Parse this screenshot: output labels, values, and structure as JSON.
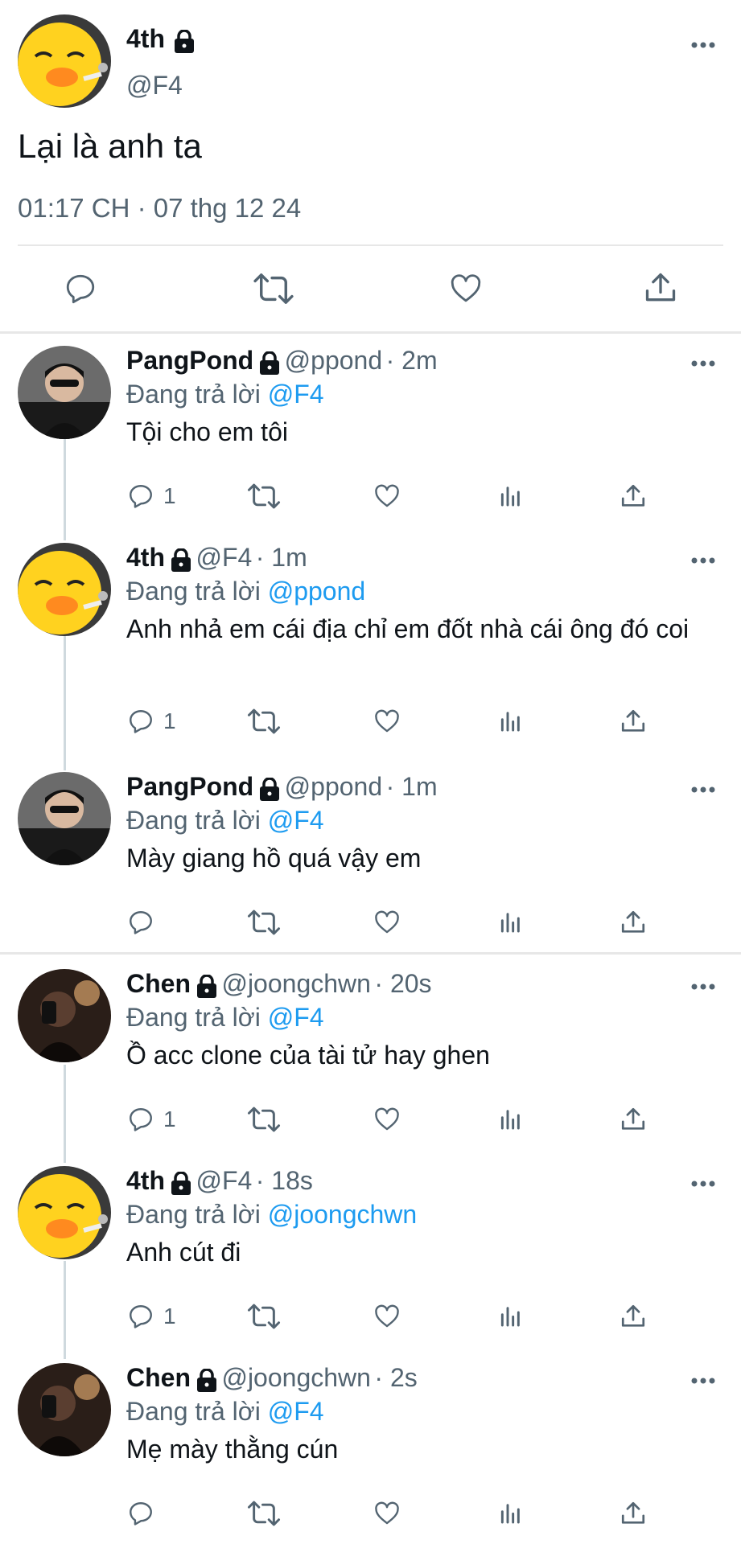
{
  "main_tweet": {
    "name": "4th",
    "handle": "@F4",
    "text": "Lại là anh ta",
    "timestamp": "01:17 CH · 07 thg 12 24"
  },
  "replies": [
    {
      "name": "PangPond",
      "handle": "@ppond",
      "time": "· 2m",
      "reply_prefix": "Đang trả lời",
      "reply_to": "@F4",
      "text": "Tội cho em tôi",
      "reply_count": "1",
      "avatar": "pangpond"
    },
    {
      "name": "4th",
      "handle": "@F4",
      "time": "· 1m",
      "reply_prefix": "Đang trả lời",
      "reply_to": "@ppond",
      "text": "Anh nhả em cái địa chỉ em đốt nhà cái ông đó coi",
      "reply_count": "1",
      "avatar": "duck"
    },
    {
      "name": "PangPond",
      "handle": "@ppond",
      "time": "· 1m",
      "reply_prefix": "Đang trả lời",
      "reply_to": "@F4",
      "text": "Mày giang hồ quá vậy em",
      "reply_count": "",
      "avatar": "pangpond"
    },
    {
      "name": "Chen",
      "handle": "@joongchwn",
      "time": "· 20s",
      "reply_prefix": "Đang trả lời",
      "reply_to": "@F4",
      "text": "Ồ acc clone của tài tử hay ghen",
      "reply_count": "1",
      "avatar": "chen"
    },
    {
      "name": "4th",
      "handle": "@F4",
      "time": "· 18s",
      "reply_prefix": "Đang trả lời",
      "reply_to": "@joongchwn",
      "text": "Anh cút đi",
      "reply_count": "1",
      "avatar": "duck"
    },
    {
      "name": "Chen",
      "handle": "@joongchwn",
      "time": "· 2s",
      "reply_prefix": "Đang trả lời",
      "reply_to": "@F4",
      "text": "Mẹ mày thằng cún",
      "reply_count": "",
      "avatar": "chen"
    }
  ],
  "colors": {
    "accent": "#1d9bf0",
    "muted": "#536471",
    "divider": "#e7e7e7"
  }
}
